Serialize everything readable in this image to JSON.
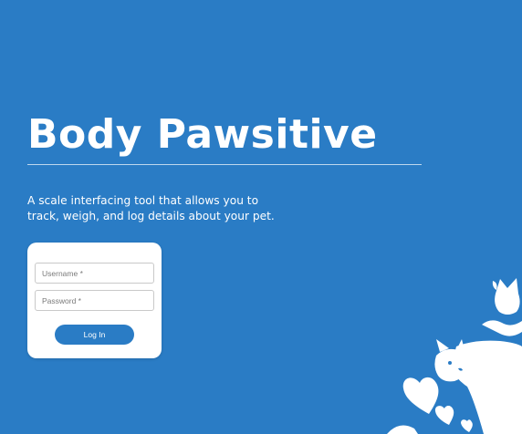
{
  "app": {
    "title": "Body Pawsitive",
    "description": "A scale interfacing tool that allows you to track, weigh, and log details about your pet."
  },
  "login": {
    "username_placeholder": "Username *",
    "password_placeholder": "Password *",
    "submit_label": "Log In"
  },
  "colors": {
    "background": "#2a7cc5",
    "card": "#ffffff",
    "button": "#2a7cc5"
  },
  "illustration": {
    "icon": "pets-with-hearts-illustration"
  }
}
